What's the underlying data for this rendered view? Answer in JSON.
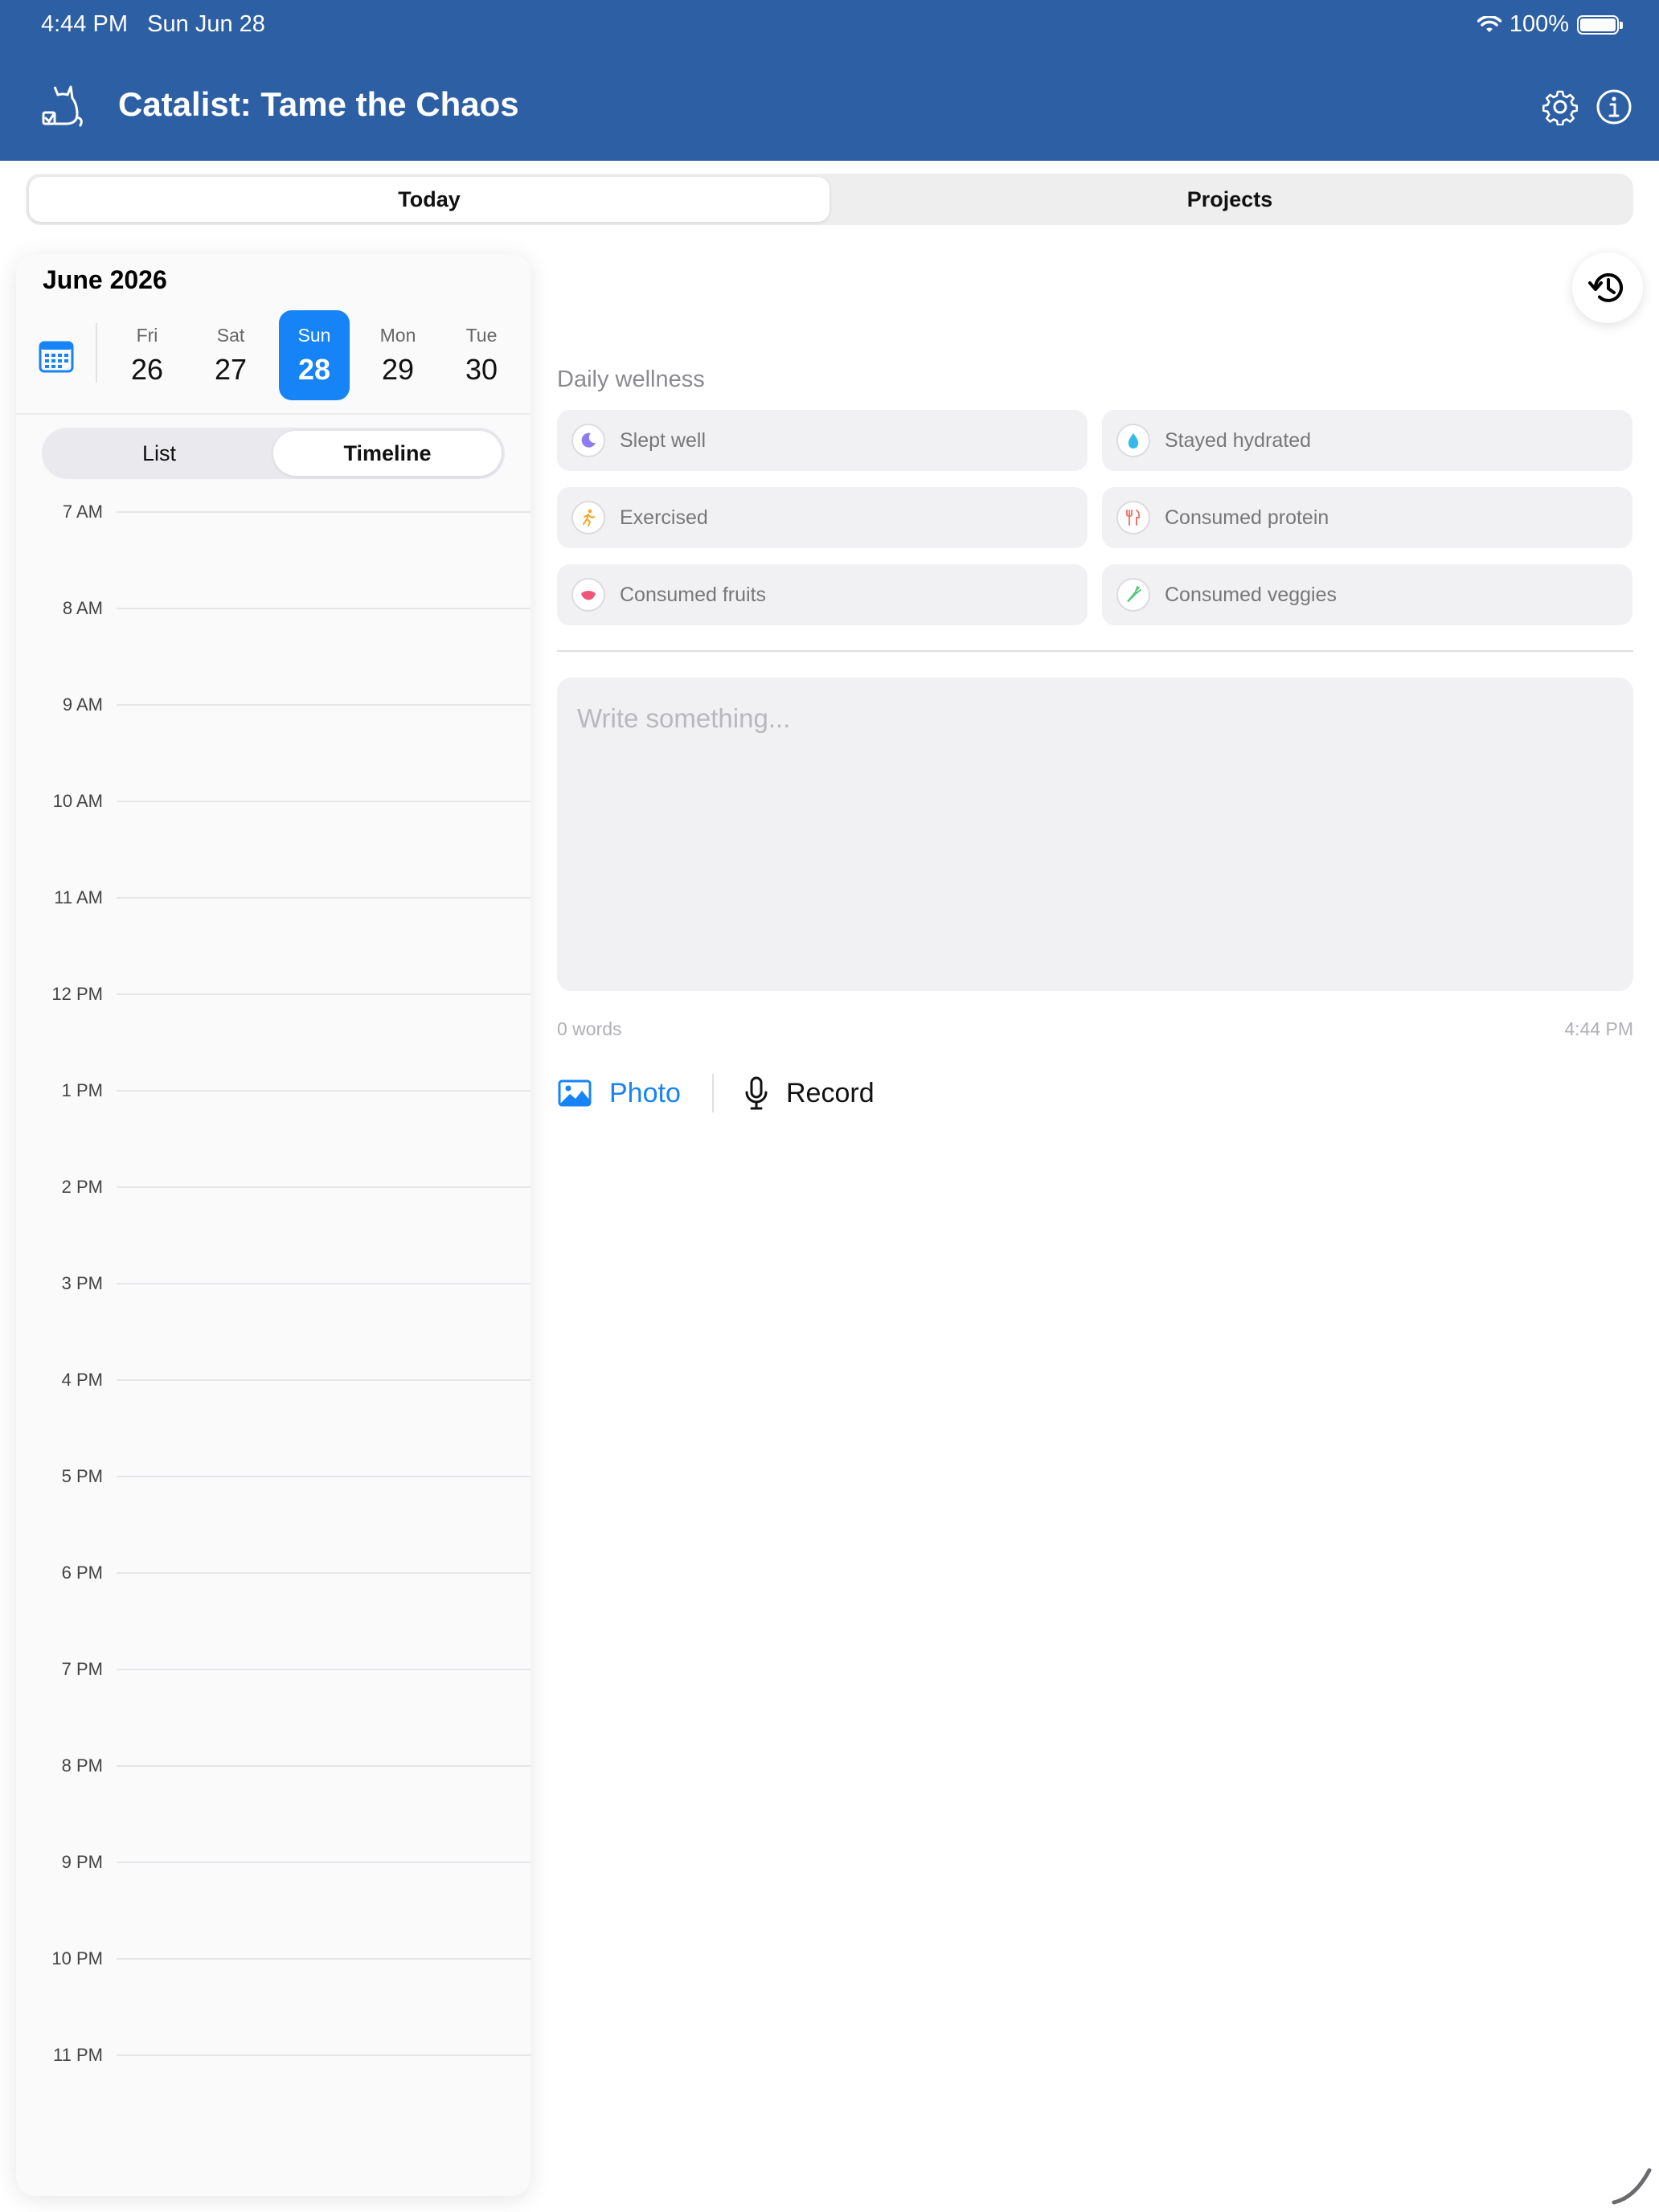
{
  "status": {
    "time": "4:44 PM",
    "date": "Sun Jun 28",
    "battery": "100%"
  },
  "header": {
    "title": "Catalist: Tame the Chaos",
    "logo_icon": "cat-checkbox-icon",
    "settings_icon": "gear-icon",
    "info_icon": "info-icon"
  },
  "main_tabs": [
    {
      "label": "Today",
      "active": true
    },
    {
      "label": "Projects",
      "active": false
    }
  ],
  "calendar": {
    "month": "June 2026",
    "days": [
      {
        "name": "Fri",
        "num": "26",
        "selected": false
      },
      {
        "name": "Sat",
        "num": "27",
        "selected": false
      },
      {
        "name": "Sun",
        "num": "28",
        "selected": true
      },
      {
        "name": "Mon",
        "num": "29",
        "selected": false
      },
      {
        "name": "Tue",
        "num": "30",
        "selected": false
      }
    ],
    "view_tabs": [
      {
        "label": "List",
        "active": false
      },
      {
        "label": "Timeline",
        "active": true
      }
    ],
    "hours": [
      "7 AM",
      "8 AM",
      "9 AM",
      "10 AM",
      "11 AM",
      "12 PM",
      "1 PM",
      "2 PM",
      "3 PM",
      "4 PM",
      "5 PM",
      "6 PM",
      "7 PM",
      "8 PM",
      "9 PM",
      "10 PM",
      "11 PM"
    ]
  },
  "wellness": {
    "title": "Daily wellness",
    "items": [
      {
        "label": "Slept well",
        "icon": "moon-icon",
        "color": "#8e7cf0"
      },
      {
        "label": "Stayed hydrated",
        "icon": "water-drop-icon",
        "color": "#35b9e6"
      },
      {
        "label": "Exercised",
        "icon": "running-icon",
        "color": "#f5a623"
      },
      {
        "label": "Consumed protein",
        "icon": "fork-knife-icon",
        "color": "#f07a6a"
      },
      {
        "label": "Consumed fruits",
        "icon": "fruit-icon",
        "color": "#f0567a"
      },
      {
        "label": "Consumed veggies",
        "icon": "carrot-icon",
        "color": "#4cc77a"
      }
    ]
  },
  "note": {
    "placeholder": "Write something...",
    "word_count": "0 words",
    "time": "4:44 PM"
  },
  "actions": {
    "photo_label": "Photo",
    "record_label": "Record"
  },
  "colors": {
    "header_bg": "#2d5fa4",
    "accent": "#1683f7"
  }
}
